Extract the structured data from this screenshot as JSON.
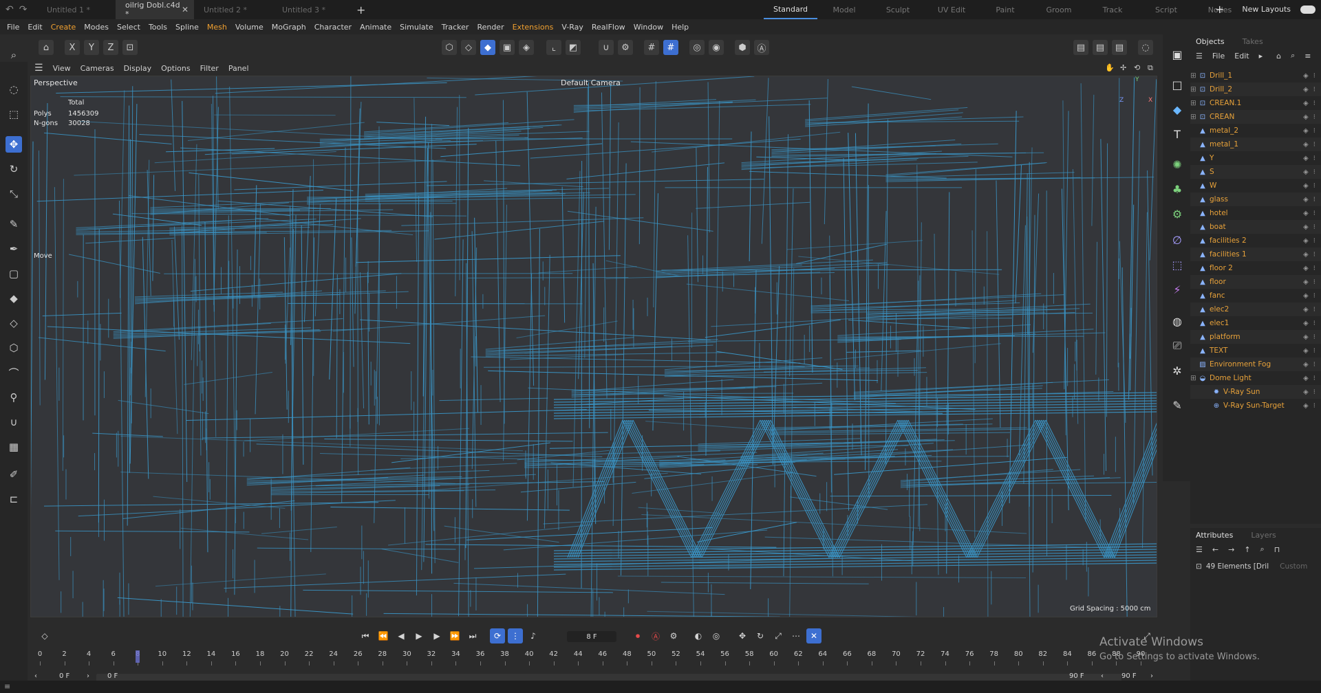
{
  "tabs": [
    {
      "label": "Untitled 1 *",
      "active": false
    },
    {
      "label": "oilrig Dobl.c4d *",
      "active": true
    },
    {
      "label": "Untitled 2 *",
      "active": false
    },
    {
      "label": "Untitled 3 *",
      "active": false
    }
  ],
  "layouts": [
    "Standard",
    "Model",
    "Sculpt",
    "UV Edit",
    "Paint",
    "Groom",
    "Track",
    "Script",
    "Nodes"
  ],
  "active_layout": "Standard",
  "new_layouts": "New Layouts",
  "menu": [
    "File",
    "Edit",
    "Create",
    "Modes",
    "Select",
    "Tools",
    "Spline",
    "Mesh",
    "Volume",
    "MoGraph",
    "Character",
    "Animate",
    "Simulate",
    "Tracker",
    "Render",
    "Extensions",
    "V-Ray",
    "RealFlow",
    "Window",
    "Help"
  ],
  "highlighted_menus": [
    "Create",
    "Mesh",
    "Extensions"
  ],
  "axes": {
    "x": "X",
    "y": "Y",
    "z": "Z"
  },
  "viewport_menu": [
    "View",
    "Cameras",
    "Display",
    "Options",
    "Filter",
    "Panel"
  ],
  "viewport": {
    "name": "Perspective",
    "camera": "Default Camera",
    "stats_header": "Total",
    "polys_label": "Polys",
    "polys_value": "1456309",
    "ngons_label": "N-gons",
    "ngons_value": "30028",
    "tool_label": "Move",
    "grid_spacing": "Grid Spacing : 5000 cm"
  },
  "objects_panel": {
    "tabs": [
      "Objects",
      "Takes"
    ],
    "menu": [
      "File",
      "Edit"
    ],
    "items": [
      {
        "name": "Drill_1",
        "icon": "group-icon",
        "expand": true
      },
      {
        "name": "Drill_2",
        "icon": "group-icon",
        "expand": true
      },
      {
        "name": "CREAN.1",
        "icon": "group-icon",
        "expand": true
      },
      {
        "name": "CREAN",
        "icon": "group-icon",
        "expand": true
      },
      {
        "name": "metal_2",
        "icon": "mesh-icon"
      },
      {
        "name": "metal_1",
        "icon": "mesh-icon"
      },
      {
        "name": "Y",
        "icon": "mesh-icon"
      },
      {
        "name": "S",
        "icon": "mesh-icon"
      },
      {
        "name": "W",
        "icon": "mesh-icon"
      },
      {
        "name": "glass",
        "icon": "mesh-icon"
      },
      {
        "name": "hotel",
        "icon": "mesh-icon"
      },
      {
        "name": "boat",
        "icon": "mesh-icon"
      },
      {
        "name": "facilities 2",
        "icon": "mesh-icon"
      },
      {
        "name": "facilities 1",
        "icon": "mesh-icon"
      },
      {
        "name": "floor 2",
        "icon": "mesh-icon"
      },
      {
        "name": "floor",
        "icon": "mesh-icon"
      },
      {
        "name": "fanc",
        "icon": "mesh-icon"
      },
      {
        "name": "elec2",
        "icon": "mesh-icon"
      },
      {
        "name": "elec1",
        "icon": "mesh-icon"
      },
      {
        "name": "platform",
        "icon": "mesh-icon"
      },
      {
        "name": "TEXT",
        "icon": "mesh-icon"
      },
      {
        "name": "Environment Fog",
        "icon": "fog-icon"
      },
      {
        "name": "Dome Light",
        "icon": "dome-light-icon",
        "expand": true
      },
      {
        "name": "V-Ray Sun",
        "icon": "sun-icon",
        "indent": true
      },
      {
        "name": "V-Ray Sun-Target",
        "icon": "target-icon",
        "indent": true
      }
    ]
  },
  "attributes_panel": {
    "tabs": [
      "Attributes",
      "Layers"
    ],
    "elements": "49 Elements [Dril",
    "mode": "Custom"
  },
  "timeline": {
    "current_frame": "8 F",
    "start_field": "0 F",
    "start_field2": "0 F",
    "end_field": "90 F",
    "end_field2": "90 F",
    "ticks": [
      "0",
      "2",
      "4",
      "6",
      "8",
      "10",
      "12",
      "14",
      "16",
      "18",
      "20",
      "22",
      "24",
      "26",
      "28",
      "30",
      "32",
      "34",
      "36",
      "38",
      "40",
      "42",
      "44",
      "46",
      "48",
      "50",
      "52",
      "54",
      "56",
      "58",
      "60",
      "62",
      "64",
      "66",
      "68",
      "70",
      "72",
      "74",
      "76",
      "78",
      "80",
      "82",
      "84",
      "86",
      "88",
      "90"
    ]
  },
  "watermark": {
    "line1": "Activate Windows",
    "line2": "Go to Settings to activate Windows."
  },
  "colors": {
    "accent": "#3d6fd1",
    "object_text": "#e8a23a",
    "wireframe": "#3a94c4"
  }
}
